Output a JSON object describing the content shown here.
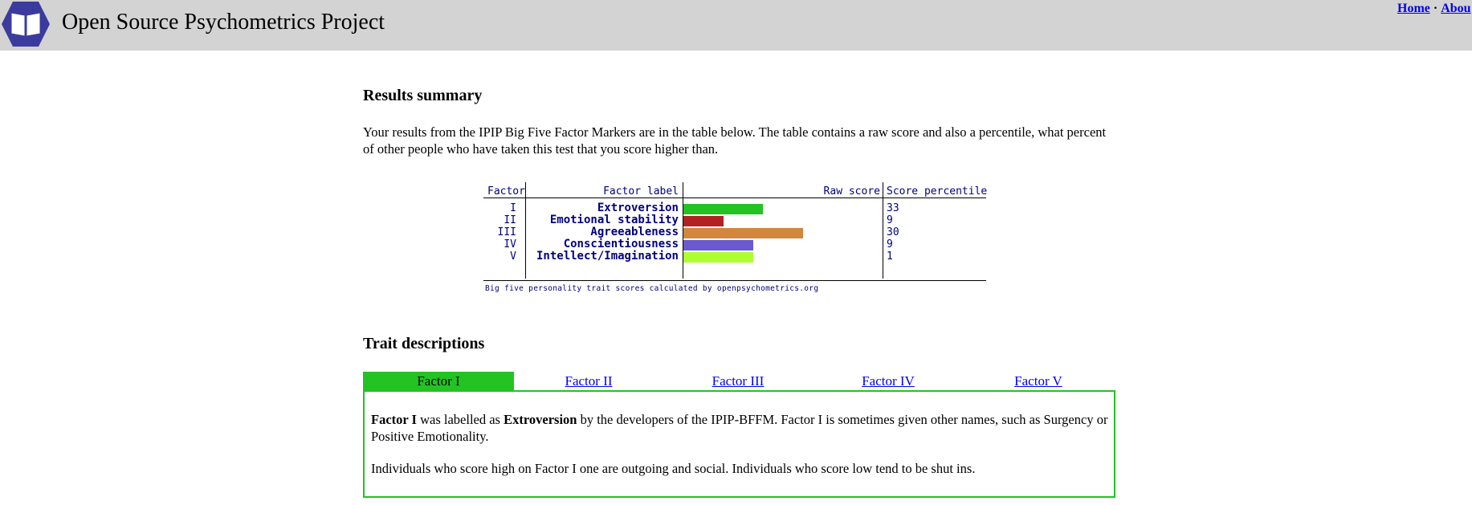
{
  "header": {
    "site_title": "Open Source Psychometrics Project",
    "nav": {
      "home": "Home",
      "separator": "·",
      "about": "Abou"
    }
  },
  "results_summary": {
    "heading": "Results summary",
    "intro": "Your results from the IPIP Big Five Factor Markers are in the table below. The table contains a raw score and also a percentile, what percent of other people who have taken this test that you score higher than."
  },
  "score_table": {
    "headers": {
      "factor": "Factor",
      "label": "Factor label",
      "raw": "Raw score",
      "percentile": "Score percentile"
    },
    "rows": [
      {
        "factor": "I",
        "label": "Extroversion",
        "raw_fraction": 0.4,
        "percentile": "33",
        "color": "#22c322"
      },
      {
        "factor": "II",
        "label": "Emotional stability",
        "raw_fraction": 0.2,
        "percentile": "9",
        "color": "#b22222"
      },
      {
        "factor": "III",
        "label": "Agreeableness",
        "raw_fraction": 0.6,
        "percentile": "30",
        "color": "#d2873c"
      },
      {
        "factor": "IV",
        "label": "Conscientiousness",
        "raw_fraction": 0.35,
        "percentile": "9",
        "color": "#6a5acd"
      },
      {
        "factor": "V",
        "label": "Intellect/Imagination",
        "raw_fraction": 0.35,
        "percentile": "1",
        "color": "#adff2f"
      }
    ],
    "caption": "Big five personality trait scores calculated by openpsychometrics.org"
  },
  "trait_descriptions": {
    "heading": "Trait descriptions",
    "tabs": [
      "Factor I",
      "Factor II",
      "Factor III",
      "Factor IV",
      "Factor V"
    ],
    "active_tab": 0,
    "panel": {
      "p1_bold1": "Factor I",
      "p1_text1": " was labelled as ",
      "p1_bold2": "Extroversion",
      "p1_text2": " by the developers of the IPIP-BFFM. Factor I is sometimes given other names, such as Surgency or Positive Emotionality.",
      "p2": "Individuals who score high on Factor I one are outgoing and social. Individuals who score low tend to be shut ins."
    }
  },
  "colors": {
    "header_bg": "#d3d3d3",
    "tab_active": "#22c322",
    "link": "#0000ee",
    "table_text": "#00007f"
  }
}
